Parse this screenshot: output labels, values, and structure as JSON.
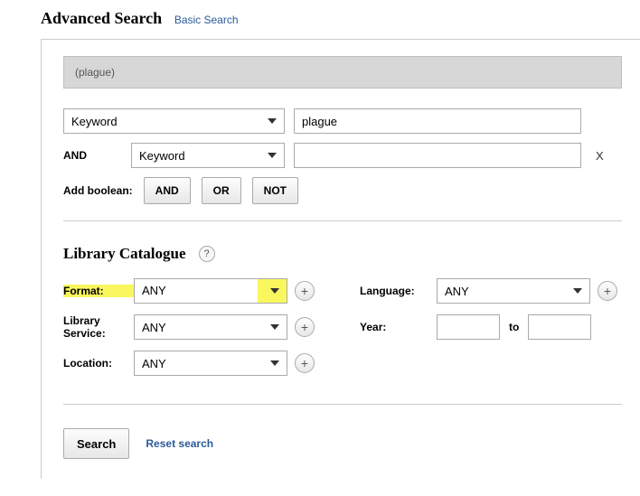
{
  "header": {
    "title": "Advanced Search",
    "basic_link": "Basic Search"
  },
  "query": "(plague)",
  "criteria": {
    "field1": "Keyword",
    "value1": "plague",
    "op": "AND",
    "field2": "Keyword",
    "value2": "",
    "remove": "X"
  },
  "boolean": {
    "label": "Add boolean:",
    "and": "AND",
    "or": "OR",
    "not": "NOT"
  },
  "library": {
    "title": "Library Catalogue",
    "help": "?",
    "format_label": "Format:",
    "format_value": "ANY",
    "service_label": "Library Service:",
    "service_value": "ANY",
    "location_label": "Location:",
    "location_value": "ANY",
    "language_label": "Language:",
    "language_value": "ANY",
    "year_label": "Year:",
    "to": "to",
    "plus": "+"
  },
  "footer": {
    "search": "Search",
    "reset": "Reset search"
  }
}
